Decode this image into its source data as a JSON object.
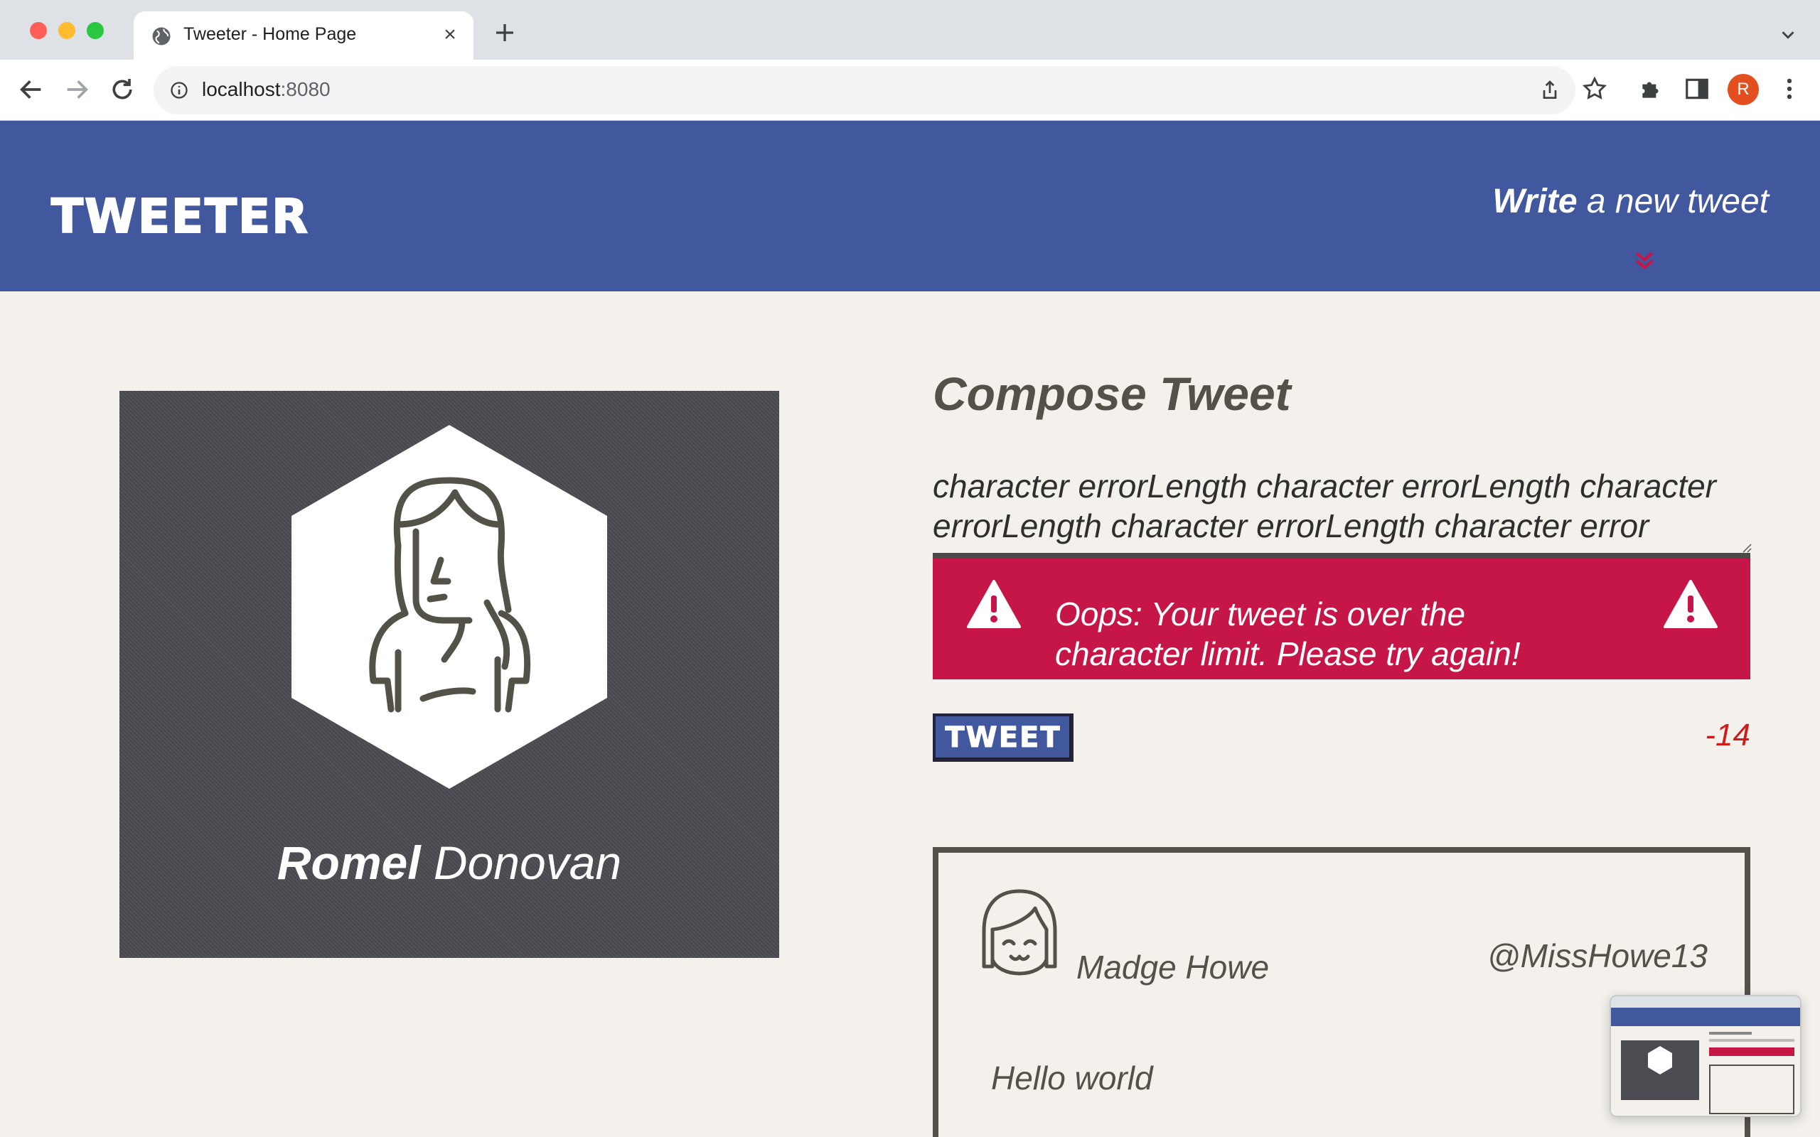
{
  "browser": {
    "tab_title": "Tweeter - Home Page",
    "url_host": "localhost",
    "url_port": ":8080",
    "profile_initial": "R"
  },
  "header": {
    "brand": "TWEETER",
    "write_bold": "Write",
    "write_rest": " a new tweet"
  },
  "profile": {
    "first_name": "Romel",
    "last_name": " Donovan"
  },
  "compose": {
    "title": "Compose Tweet",
    "text": "character errorLength character errorLength character errorLength character errorLength character error",
    "error_message": "Oops: Your tweet is over the character limit. Please try again!",
    "button_label": "TWEET",
    "counter": "-14"
  },
  "tweet": {
    "name": "Madge Howe",
    "handle": "@MissHowe13",
    "content": "Hello world"
  },
  "colors": {
    "header_blue": "#42589e",
    "error_red": "#c61647",
    "background": "#f4f1ec",
    "text_dark": "#545149",
    "counter_red": "#d11a1a"
  }
}
